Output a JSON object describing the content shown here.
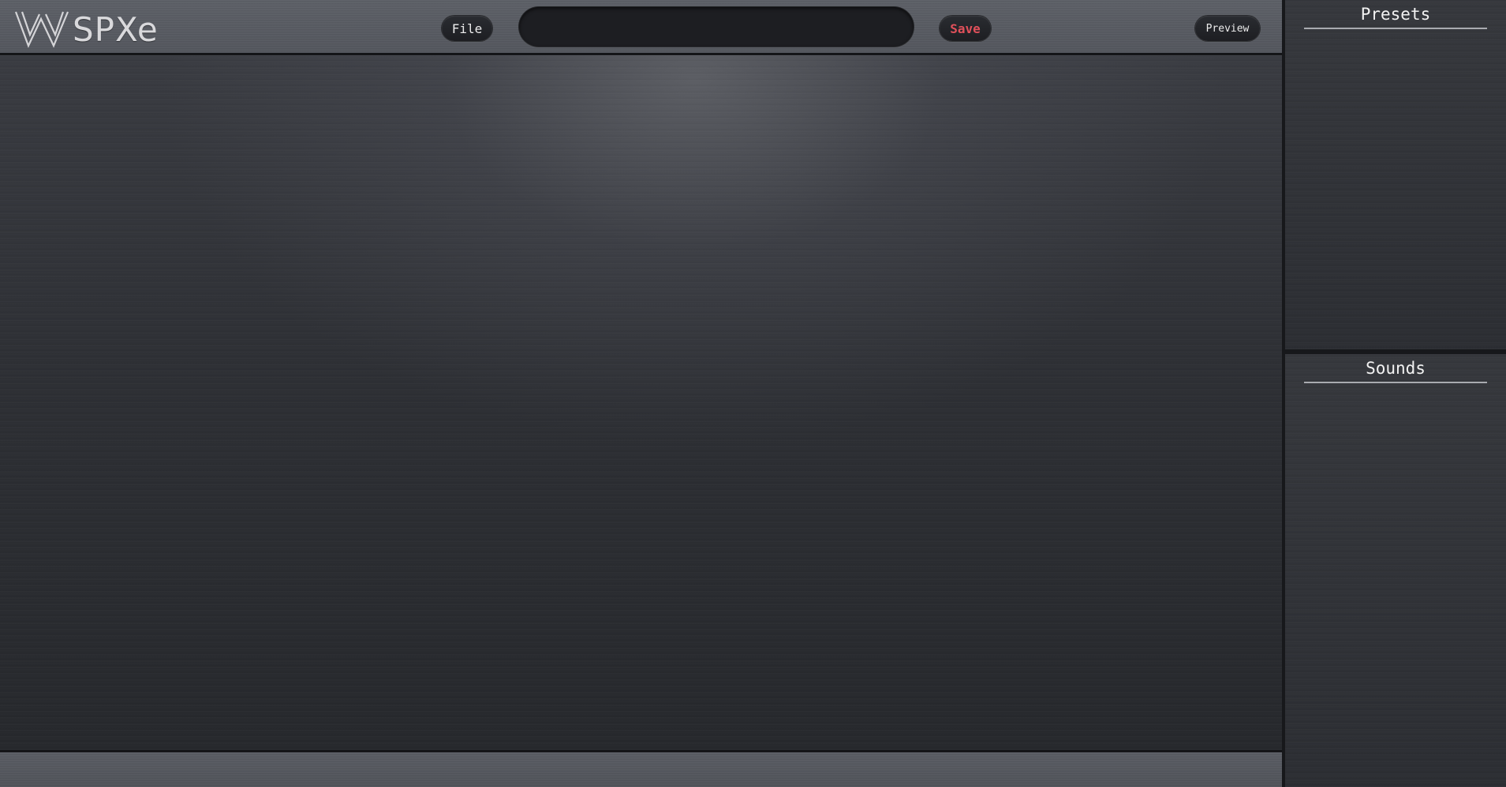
{
  "app": {
    "logo_text": "SPXe"
  },
  "toolbar": {
    "file_label": "File",
    "save_label": "Save",
    "preview_label": "Preview",
    "name_field_value": "",
    "save_color": "#e0505a"
  },
  "sidebar": {
    "presets_title": "Presets",
    "sounds_title": "Sounds"
  }
}
